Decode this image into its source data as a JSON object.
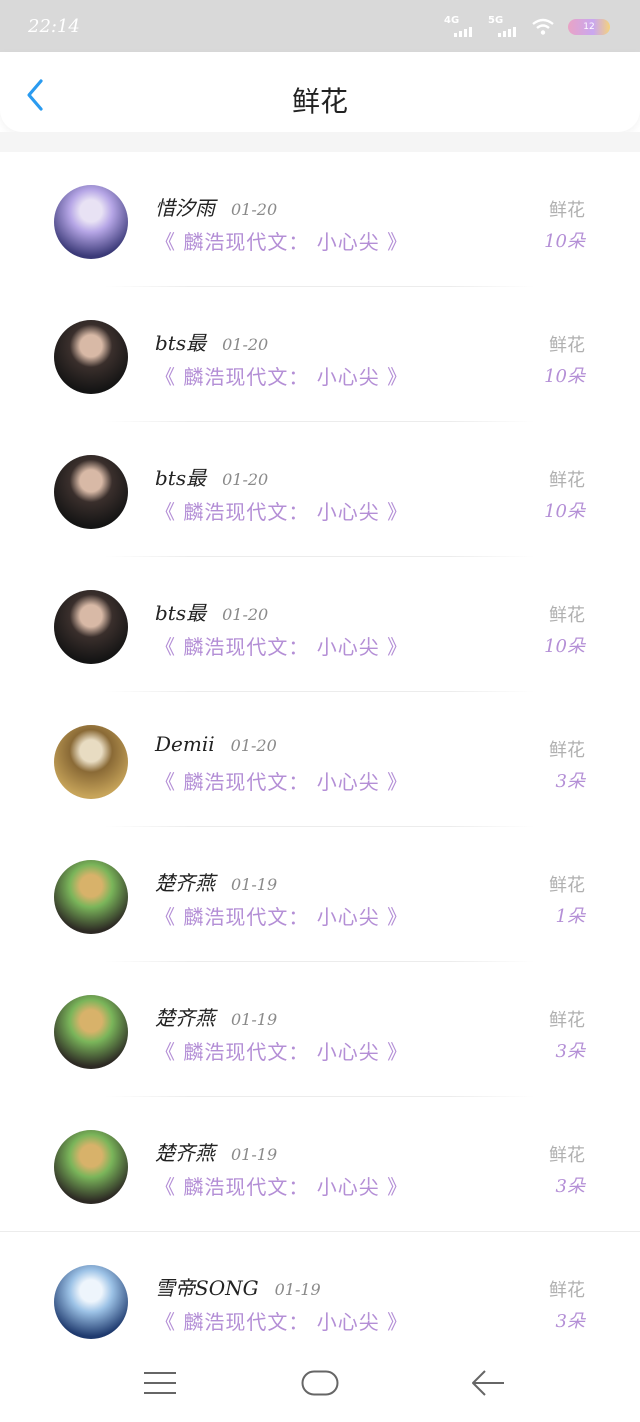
{
  "status": {
    "time": "22:14",
    "signal1_label": "4G",
    "signal2_label": "5G",
    "battery": "12"
  },
  "header": {
    "title": "鲜花",
    "back_icon": "chevron-left-icon",
    "accent": "#2a9bf0"
  },
  "items": [
    {
      "name": "惜汐雨",
      "date": "01-20",
      "work": "《 麟浩现代文： 小心尖 》",
      "flower_label": "鲜花",
      "count": "10朵",
      "avatar_colors": [
        "#3b3a78",
        "#b6a6e6",
        "#e8e2f4"
      ]
    },
    {
      "name": "bts最",
      "date": "01-20",
      "work": "《 麟浩现代文： 小心尖 》",
      "flower_label": "鲜花",
      "count": "10朵",
      "avatar_colors": [
        "#141414",
        "#3a2f2c",
        "#d8b9a6"
      ]
    },
    {
      "name": "bts最",
      "date": "01-20",
      "work": "《 麟浩现代文： 小心尖 》",
      "flower_label": "鲜花",
      "count": "10朵",
      "avatar_colors": [
        "#141414",
        "#3a2f2c",
        "#d8b9a6"
      ]
    },
    {
      "name": "bts最",
      "date": "01-20",
      "work": "《 麟浩现代文： 小心尖 》",
      "flower_label": "鲜花",
      "count": "10朵",
      "avatar_colors": [
        "#141414",
        "#3a2f2c",
        "#d8b9a6"
      ]
    },
    {
      "name": "Demii",
      "date": "01-20",
      "work": "《 麟浩现代文： 小心尖 》",
      "flower_label": "鲜花",
      "count": "3朵",
      "avatar_colors": [
        "#c7a45a",
        "#8a6a36",
        "#e8dcc2"
      ]
    },
    {
      "name": "楚齐燕",
      "date": "01-19",
      "work": "《 麟浩现代文： 小心尖 》",
      "flower_label": "鲜花",
      "count": "1朵",
      "avatar_colors": [
        "#2d2a24",
        "#7ab55a",
        "#d8b26a"
      ]
    },
    {
      "name": "楚齐燕",
      "date": "01-19",
      "work": "《 麟浩现代文： 小心尖 》",
      "flower_label": "鲜花",
      "count": "3朵",
      "avatar_colors": [
        "#2d2a24",
        "#7ab55a",
        "#d8b26a"
      ]
    },
    {
      "name": "楚齐燕",
      "date": "01-19",
      "work": "《 麟浩现代文： 小心尖 》",
      "flower_label": "鲜花",
      "count": "3朵",
      "avatar_colors": [
        "#2d2a24",
        "#7ab55a",
        "#d8b26a"
      ]
    },
    {
      "name": "雪帝SONG",
      "date": "01-19",
      "work": "《 麟浩现代文： 小心尖 》",
      "flower_label": "鲜花",
      "count": "3朵",
      "avatar_colors": [
        "#1f3a6e",
        "#9cc2e6",
        "#eef5fc"
      ]
    }
  ],
  "nav": {
    "menu_icon": "menu-icon",
    "home_icon": "home-icon",
    "back_icon": "back-arrow-icon"
  }
}
